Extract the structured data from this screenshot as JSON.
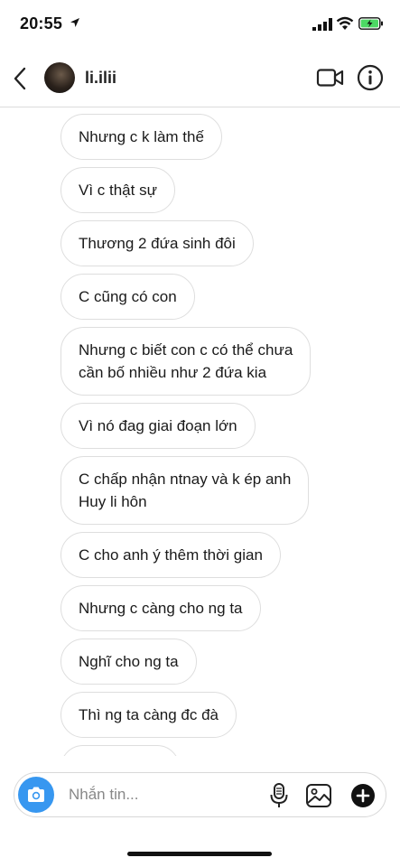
{
  "status_bar": {
    "time": "20:55"
  },
  "header": {
    "username": "li.ilii"
  },
  "messages": [
    "Nhưng c k làm thế",
    "Vì c thật sự",
    "Thương 2 đứa sinh đôi",
    "C cũng có con",
    "Nhưng c biết con c có thể chưa\ncần bố nhiều như 2 đứa kia",
    "Vì nó đag giai đoạn lớn",
    "C chấp nhận ntnay và k ép anh\nHuy li hôn",
    "C cho anh ý thêm thời gian",
    "Nhưng c càng cho ng ta",
    "Nghĩ cho ng ta",
    "Thì ng ta càng đc đà"
  ],
  "composer": {
    "placeholder": "Nhắn tin..."
  },
  "colors": {
    "accent": "#3797f0",
    "bubble_border": "#dedede",
    "battery": "#4cd964"
  },
  "icons": [
    "location-arrow-icon",
    "signal-icon",
    "wifi-icon",
    "battery-icon",
    "back-chevron-icon",
    "video-call-icon",
    "info-icon",
    "camera-icon",
    "microphone-icon",
    "gallery-icon",
    "plus-icon"
  ]
}
